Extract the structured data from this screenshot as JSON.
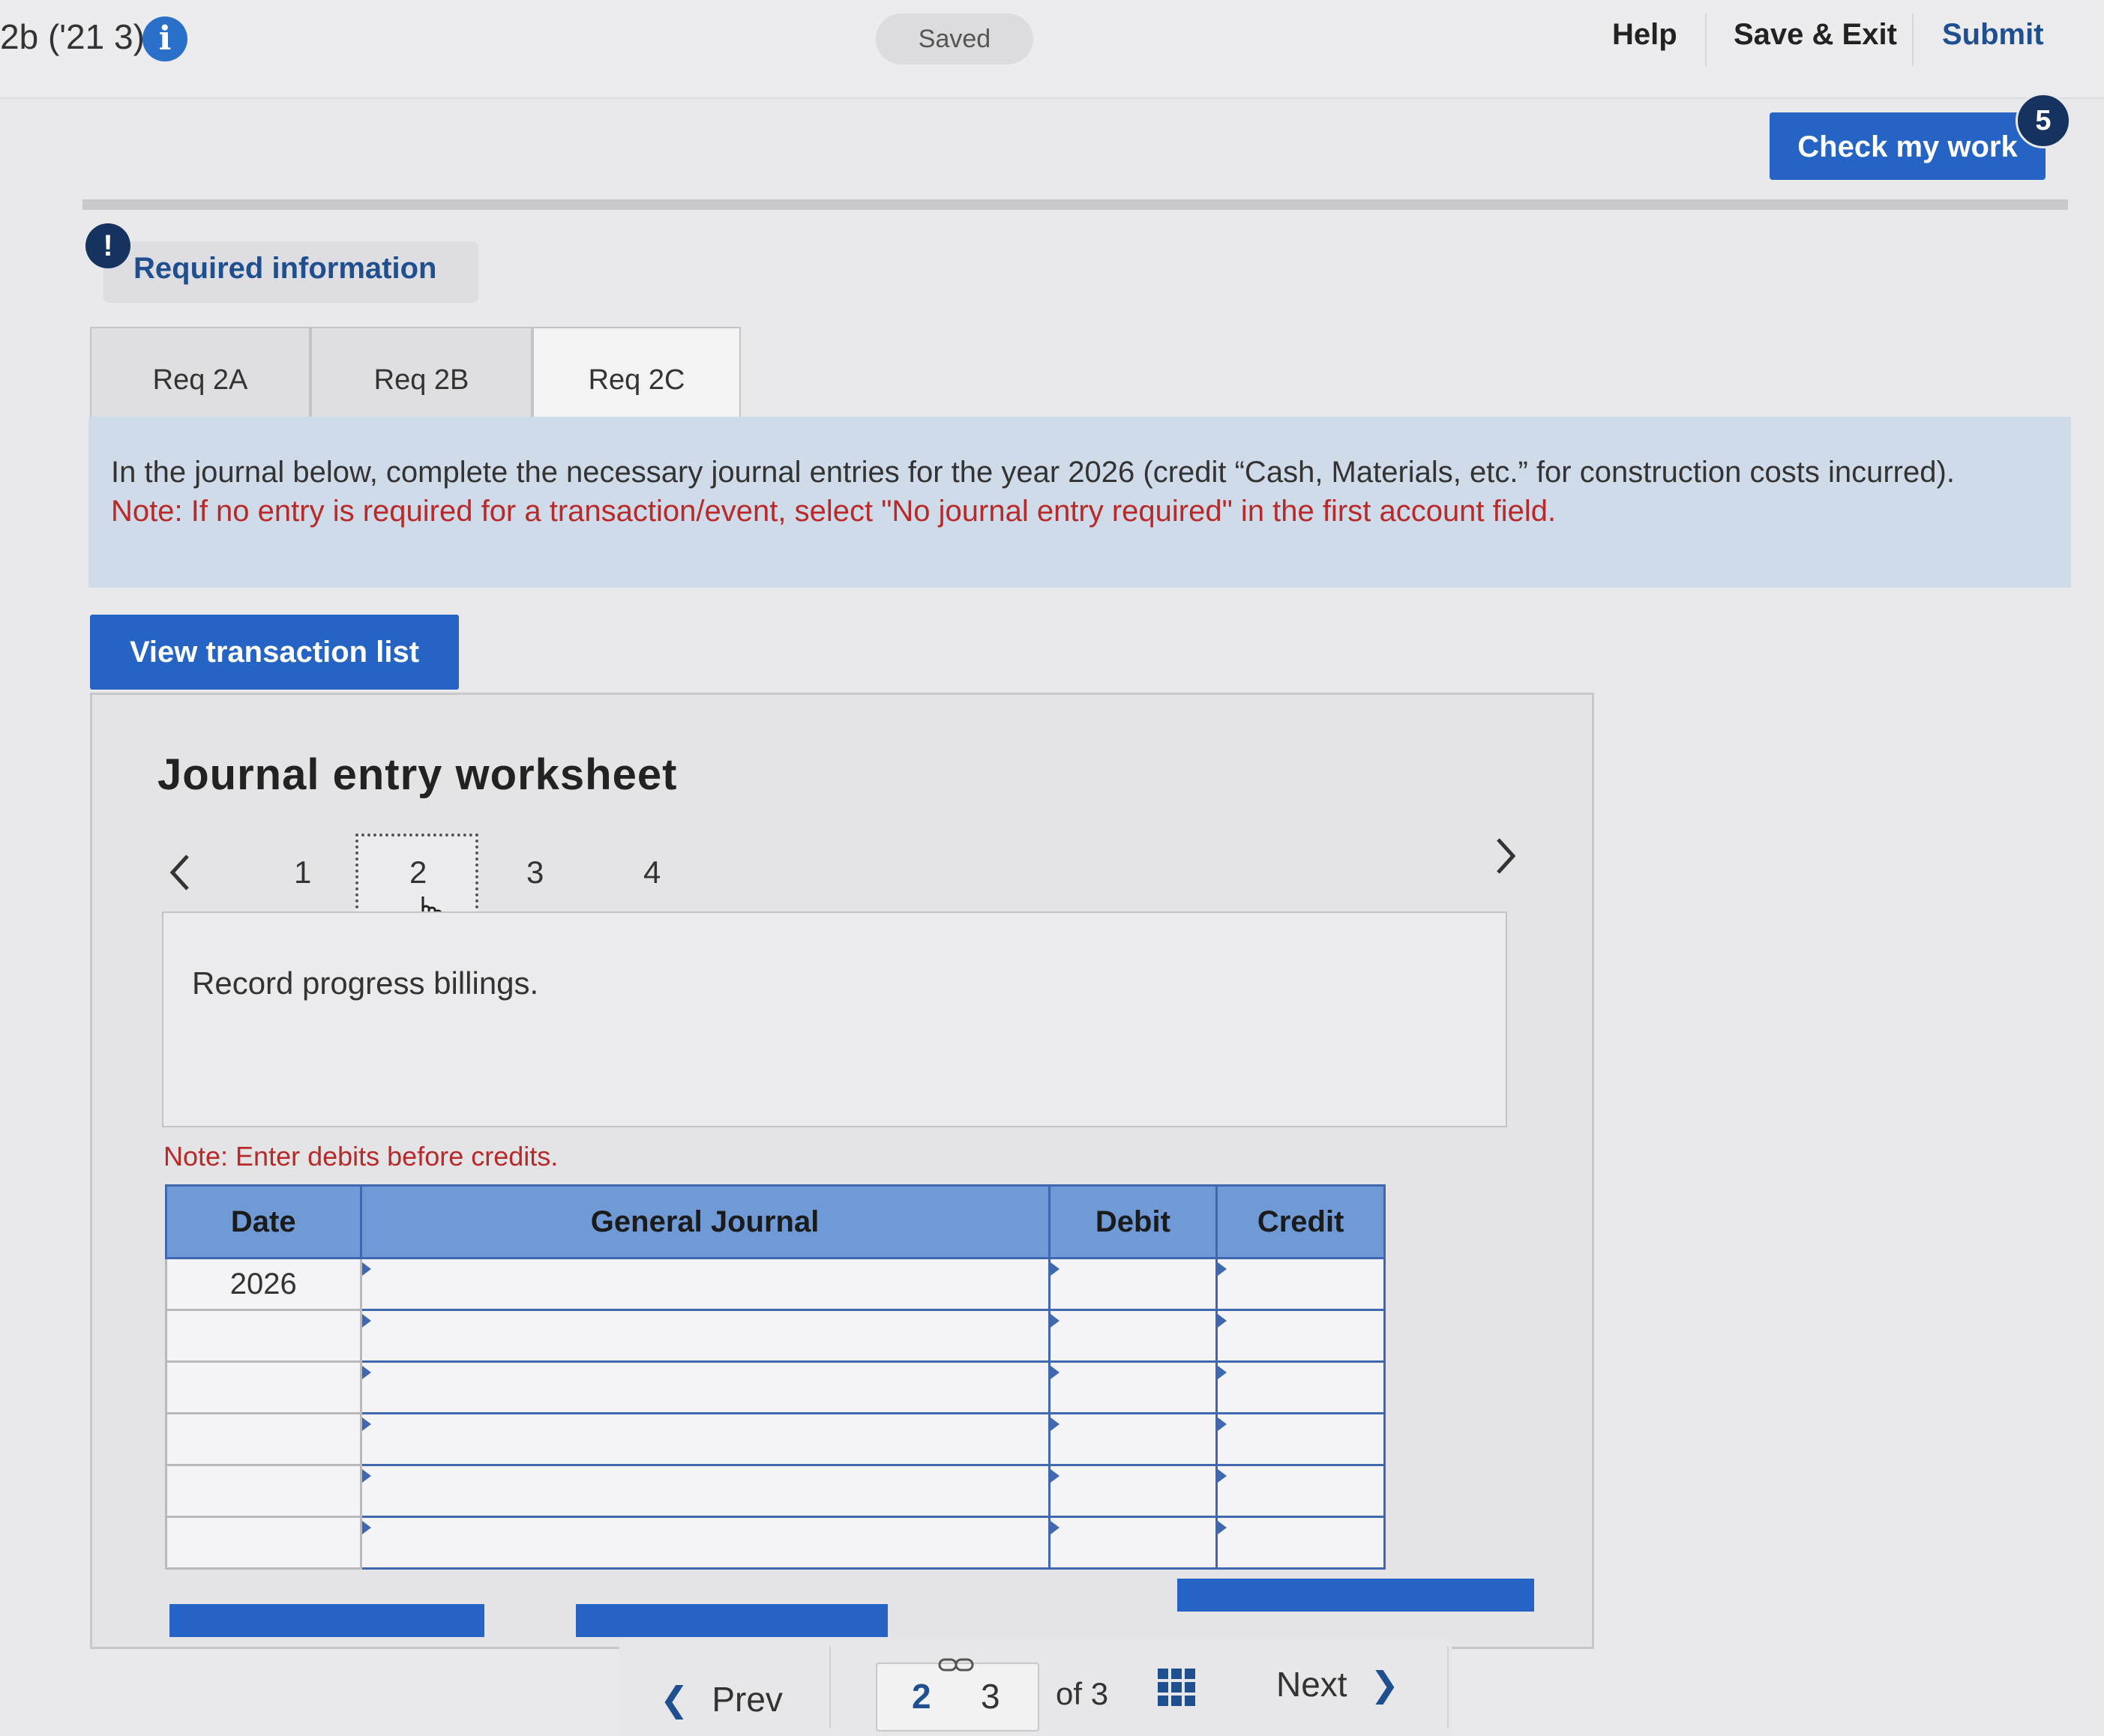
{
  "header": {
    "crumb": "2b ('21 3)",
    "saved_label": "Saved",
    "help_label": "Help",
    "save_exit_label": "Save & Exit",
    "submit_label": "Submit",
    "check_work_label": "Check my work",
    "check_work_badge": "5"
  },
  "required_info": {
    "label": "Required information",
    "icon": "!"
  },
  "tabs": [
    {
      "label": "Req 2A",
      "active": false
    },
    {
      "label": "Req 2B",
      "active": false
    },
    {
      "label": "Req 2C",
      "active": true
    }
  ],
  "instruction": {
    "text": "In the journal below, complete the necessary journal entries for the year 2026 (credit “Cash, Materials, etc.” for construction costs incurred).",
    "note": "Note: If no entry is required for a transaction/event, select \"No journal entry required\" in the first account field."
  },
  "view_transactions_label": "View transaction list",
  "worksheet": {
    "title": "Journal entry worksheet",
    "entries": [
      "1",
      "2",
      "3",
      "4"
    ],
    "active_entry": "2",
    "description": "Record progress billings.",
    "debit_note": "Note: Enter debits before credits.",
    "columns": [
      "Date",
      "General Journal",
      "Debit",
      "Credit"
    ],
    "rows": [
      {
        "date": "2026",
        "account": "",
        "debit": "",
        "credit": ""
      },
      {
        "date": "",
        "account": "",
        "debit": "",
        "credit": ""
      },
      {
        "date": "",
        "account": "",
        "debit": "",
        "credit": ""
      },
      {
        "date": "",
        "account": "",
        "debit": "",
        "credit": ""
      },
      {
        "date": "",
        "account": "",
        "debit": "",
        "credit": ""
      },
      {
        "date": "",
        "account": "",
        "debit": "",
        "credit": ""
      }
    ]
  },
  "pagination": {
    "prev_label": "Prev",
    "current": "2",
    "next_page": "3",
    "of_label": "of 3",
    "next_label": "Next"
  },
  "colors": {
    "primary_blue": "#2563c4",
    "header_blue": "#6f9ad6",
    "note_red": "#b82a2a",
    "navy": "#16325f"
  }
}
